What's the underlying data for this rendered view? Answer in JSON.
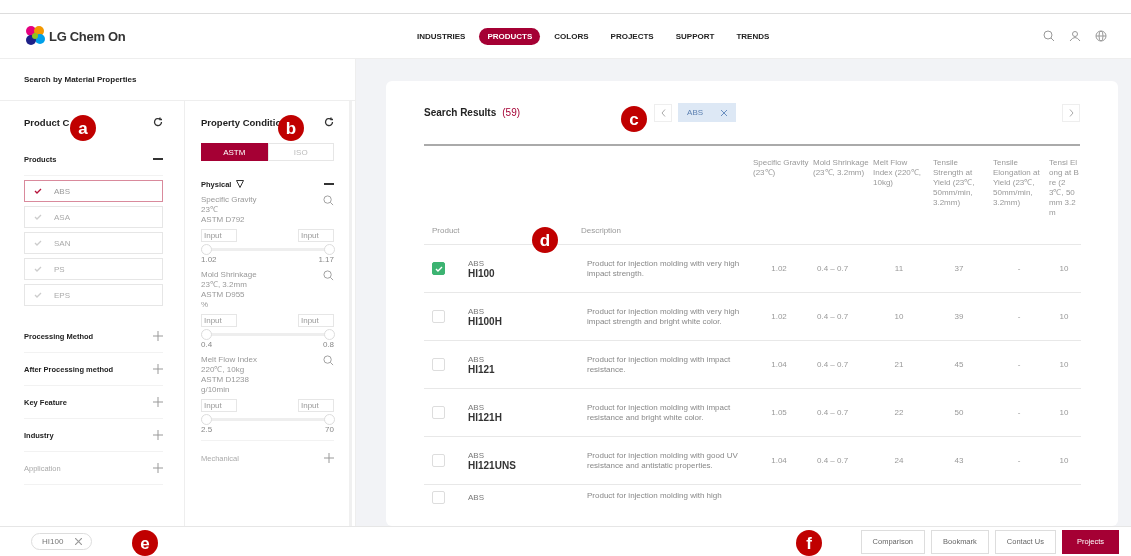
{
  "header": {
    "logo": "LG Chem On",
    "nav": [
      {
        "label": "INDUSTRIES",
        "selected": false
      },
      {
        "label": "PRODUCTS",
        "selected": true
      },
      {
        "label": "COLORS",
        "selected": false
      },
      {
        "label": "PROJECTS",
        "selected": false
      },
      {
        "label": "SUPPORT",
        "selected": false
      },
      {
        "label": "TRENDS",
        "selected": false
      }
    ]
  },
  "panel_title": "Search by Material Properties",
  "product_category": {
    "title": "Product C",
    "sections": [
      {
        "label": "Products",
        "expanded": true,
        "disabled": false,
        "items": [
          {
            "label": "ABS",
            "checked": true
          },
          {
            "label": "ASA",
            "checked": false
          },
          {
            "label": "SAN",
            "checked": false
          },
          {
            "label": "PS",
            "checked": false
          },
          {
            "label": "EPS",
            "checked": false
          }
        ]
      },
      {
        "label": "Processing Method",
        "expanded": false,
        "disabled": false
      },
      {
        "label": "After Processing method",
        "expanded": false,
        "disabled": false
      },
      {
        "label": "Key Feature",
        "expanded": false,
        "disabled": false
      },
      {
        "label": "Industry",
        "expanded": false,
        "disabled": false
      },
      {
        "label": "Application",
        "expanded": false,
        "disabled": true
      }
    ]
  },
  "property_condition": {
    "title": "Property Conditio",
    "tabs": [
      {
        "label": "ASTM",
        "selected": true
      },
      {
        "label": "ISO",
        "selected": false
      }
    ],
    "groups": [
      {
        "label": "Physical",
        "expanded": true,
        "properties": [
          {
            "lines": [
              "Specific Gravity",
              "23℃",
              "ASTM D792"
            ],
            "min_placeholder": "Input",
            "max_placeholder": "Input",
            "min": "1.02",
            "max": "1.17",
            "level": 1
          },
          {
            "lines": [
              "Mold Shrinkage",
              "23℃, 3.2mm",
              "ASTM D955",
              "%"
            ],
            "min_placeholder": "Input",
            "max_placeholder": "Input",
            "min": "0.4",
            "max": "0.8",
            "level": 1
          },
          {
            "lines": [
              "Melt Flow Index",
              "220℃, 10kg",
              "ASTM D1238",
              "g/10min"
            ],
            "min_placeholder": "Input",
            "max_placeholder": "Input",
            "min": "2.5",
            "max": "70",
            "level": 1
          }
        ]
      },
      {
        "label": "Mechanical",
        "expanded": false
      }
    ]
  },
  "results": {
    "title": "Search Results",
    "count": "(59)",
    "filters": [
      {
        "label": "ABS"
      }
    ],
    "columns": [
      "Product",
      "Description",
      "Specific Gravity (23℃)",
      "Mold Shrinkage (23℃, 3.2mm)",
      "Melt Flow Index (220℃, 10kg)",
      "Tensile Strength at Yield (23℃, 50mm/min, 3.2mm)",
      "Tensile Elongation at Yield (23℃, 50mm/min, 3.2mm)",
      "Tensi Elong at Bre (23℃, 50mm 3.2m"
    ],
    "rows": [
      {
        "selected": true,
        "category": "ABS",
        "name": "HI100",
        "description": "Product for injection molding with very high impact strength.",
        "values": [
          "1.02",
          "0.4 – 0.7",
          "11",
          "37",
          "-",
          "10"
        ]
      },
      {
        "selected": false,
        "category": "ABS",
        "name": "HI100H",
        "description": "Product for injection molding with very high impact strength and bright white color.",
        "values": [
          "1.02",
          "0.4 – 0.7",
          "10",
          "39",
          "-",
          "10"
        ]
      },
      {
        "selected": false,
        "category": "ABS",
        "name": "HI121",
        "description": "Product for injection molding with impact resistance.",
        "values": [
          "1.04",
          "0.4 – 0.7",
          "21",
          "45",
          "-",
          "10"
        ]
      },
      {
        "selected": false,
        "category": "ABS",
        "name": "HI121H",
        "description": "Product for injection molding with impact resistance and bright white color.",
        "values": [
          "1.05",
          "0.4 – 0.7",
          "22",
          "50",
          "-",
          "10"
        ]
      },
      {
        "selected": false,
        "category": "ABS",
        "name": "HI121UNS",
        "description": "Product for injection molding with good UV resistance and antistatic properties.",
        "values": [
          "1.04",
          "0.4 – 0.7",
          "24",
          "43",
          "-",
          "10"
        ]
      },
      {
        "selected": false,
        "category": "ABS",
        "name": "",
        "description": "Product for injection molding with high",
        "values": []
      }
    ]
  },
  "footer": {
    "chips": [
      {
        "label": "HI100"
      }
    ],
    "buttons": [
      {
        "label": "Comparison",
        "kind": "plain"
      },
      {
        "label": "Bookmark",
        "kind": "plain"
      },
      {
        "label": "Contact Us",
        "kind": "plain"
      },
      {
        "label": "Projects",
        "kind": "primary"
      }
    ]
  },
  "callouts": [
    {
      "label": "a"
    },
    {
      "label": "b"
    },
    {
      "label": "c"
    },
    {
      "label": "d"
    },
    {
      "label": "e"
    },
    {
      "label": "f"
    }
  ]
}
